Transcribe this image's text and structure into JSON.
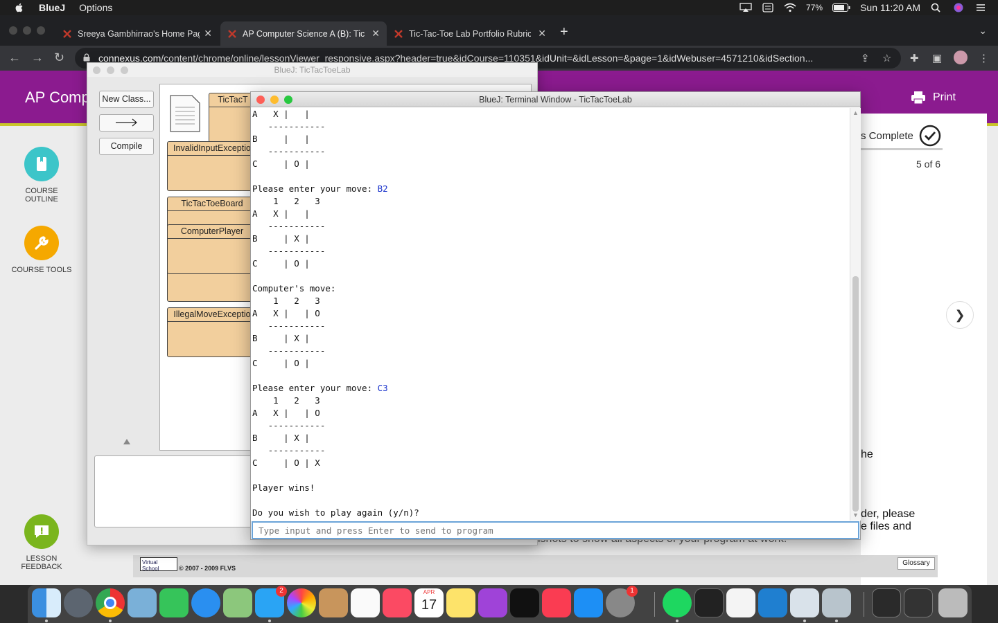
{
  "menubar": {
    "app": "BlueJ",
    "menu": [
      "Options"
    ],
    "battery": "77%",
    "clock": "Sun 11:20 AM"
  },
  "browser": {
    "tabs": [
      {
        "title": "Sreeya Gambhirrao's Home Page"
      },
      {
        "title": "AP Computer Science A (B): Tic"
      },
      {
        "title": "Tic-Tac-Toe Lab Portfolio Rubric"
      }
    ],
    "url_domain": "connexus.com",
    "url_path": "/content/chrome/online/lessonViewer_responsive.aspx?header=true&idCourse=110351&idUnit=&idLesson=&page=1&idWebuser=4571210&idSection..."
  },
  "lesson": {
    "title": "AP Comp",
    "print_label": "Print",
    "complete_label": "s Complete",
    "pager": "5 of 6",
    "frag_1": "he",
    "frag_2": "der, please",
    "frag_3": "e files and",
    "frag_4": "ishots to show all aspects of your program at work.",
    "side": {
      "course_outline": [
        "COURSE",
        "OUTLINE"
      ],
      "course_tools": "COURSE TOOLS",
      "lesson_feedback": [
        "LESSON",
        "FEEDBACK"
      ]
    },
    "footer_copy": "© 2007 - 2009 FLVS",
    "footer_logo": "Virtual School",
    "glossary": "Glossary"
  },
  "bluej": {
    "title": "BlueJ:  TicTacToeLab",
    "buttons": {
      "new_class": "New Class...",
      "compile": "Compile"
    },
    "classes": [
      "TicTacT",
      "InvalidInputExceptio",
      "TicTacToeBoard",
      "ComputerPlayer",
      "IllegalMoveExceptio"
    ]
  },
  "terminal": {
    "title": "BlueJ: Terminal Window - TicTacToeLab",
    "input_placeholder": "Type input and press Enter to send to program",
    "lines": [
      {
        "t": "A   X |   |"
      },
      {
        "t": "   -----------"
      },
      {
        "t": "B     |   |"
      },
      {
        "t": "   -----------"
      },
      {
        "t": "C     | O |"
      },
      {
        "t": ""
      },
      {
        "t": "Please enter your move: ",
        "input": "B2"
      },
      {
        "t": "    1   2   3"
      },
      {
        "t": "A   X |   |"
      },
      {
        "t": "   -----------"
      },
      {
        "t": "B     | X |"
      },
      {
        "t": "   -----------"
      },
      {
        "t": "C     | O |"
      },
      {
        "t": ""
      },
      {
        "t": "Computer's move:"
      },
      {
        "t": "    1   2   3"
      },
      {
        "t": "A   X |   | O"
      },
      {
        "t": "   -----------"
      },
      {
        "t": "B     | X |"
      },
      {
        "t": "   -----------"
      },
      {
        "t": "C     | O |"
      },
      {
        "t": ""
      },
      {
        "t": "Please enter your move: ",
        "input": "C3"
      },
      {
        "t": "    1   2   3"
      },
      {
        "t": "A   X |   | O"
      },
      {
        "t": "   -----------"
      },
      {
        "t": "B     | X |"
      },
      {
        "t": "   -----------"
      },
      {
        "t": "C     | O | X"
      },
      {
        "t": ""
      },
      {
        "t": "Player wins!"
      },
      {
        "t": ""
      },
      {
        "t": "Do you wish to play again (y/n)?"
      }
    ]
  },
  "dock": {
    "apps": [
      "finder",
      "launchpad",
      "chrome",
      "preview",
      "facetime",
      "safari",
      "maps",
      "messages",
      "photos",
      "contacts",
      "reminders",
      "music",
      "calendar",
      "notes",
      "podcasts",
      "apple-tv",
      "news",
      "app-store",
      "system-preferences",
      "spotify",
      "terminal",
      "textedit",
      "vscode",
      "bluej",
      "bluej-alt"
    ],
    "messages_badge": "2",
    "sysprefs_badge": "1",
    "calendar_month": "APR",
    "calendar_day": "17"
  }
}
